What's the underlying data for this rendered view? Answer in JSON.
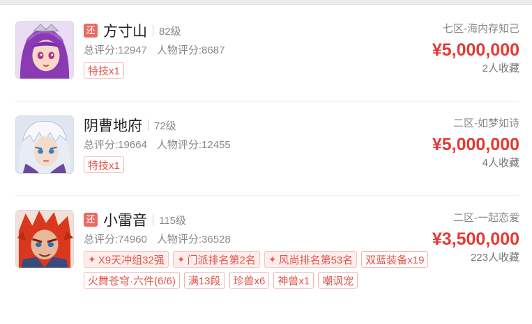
{
  "listings": [
    {
      "returning": true,
      "return_badge": "还",
      "school": "方寸山",
      "level": "82级",
      "total_score": "总评分:12947",
      "char_score": "人物评分:8687",
      "hot_tags": [],
      "tags": [
        "特技x1"
      ],
      "server": "七区-海内存知己",
      "price": "¥5,000,000",
      "favorites": "2人收藏",
      "avatar_icon": "purple-haired-female-portrait"
    },
    {
      "returning": false,
      "return_badge": "",
      "school": "阴曹地府",
      "level": "72级",
      "total_score": "总评分:19664",
      "char_score": "人物评分:12455",
      "hot_tags": [],
      "tags": [
        "特技x1"
      ],
      "server": "二区-如梦如诗",
      "price": "¥5,000,000",
      "favorites": "4人收藏",
      "avatar_icon": "white-haired-male-portrait"
    },
    {
      "returning": true,
      "return_badge": "还",
      "school": "小雷音",
      "level": "115级",
      "total_score": "总评分:74960",
      "char_score": "人物评分:36528",
      "hot_tags": [
        "X9天冲组32强",
        "门派排名第2名",
        "风尚排名第53名"
      ],
      "tags": [
        "双蓝装备x19",
        "火舞苍穹·六件(6/6)",
        "满13段",
        "珍兽x6",
        "神兽x1",
        "嘲讽宠"
      ],
      "server": "二区-一起恋爱",
      "price": "¥3,500,000",
      "favorites": "223人收藏",
      "avatar_icon": "red-haired-demon-portrait"
    }
  ],
  "colors": {
    "price": "#e53935",
    "tag": "#e4544b",
    "badge": "#e86a62"
  }
}
